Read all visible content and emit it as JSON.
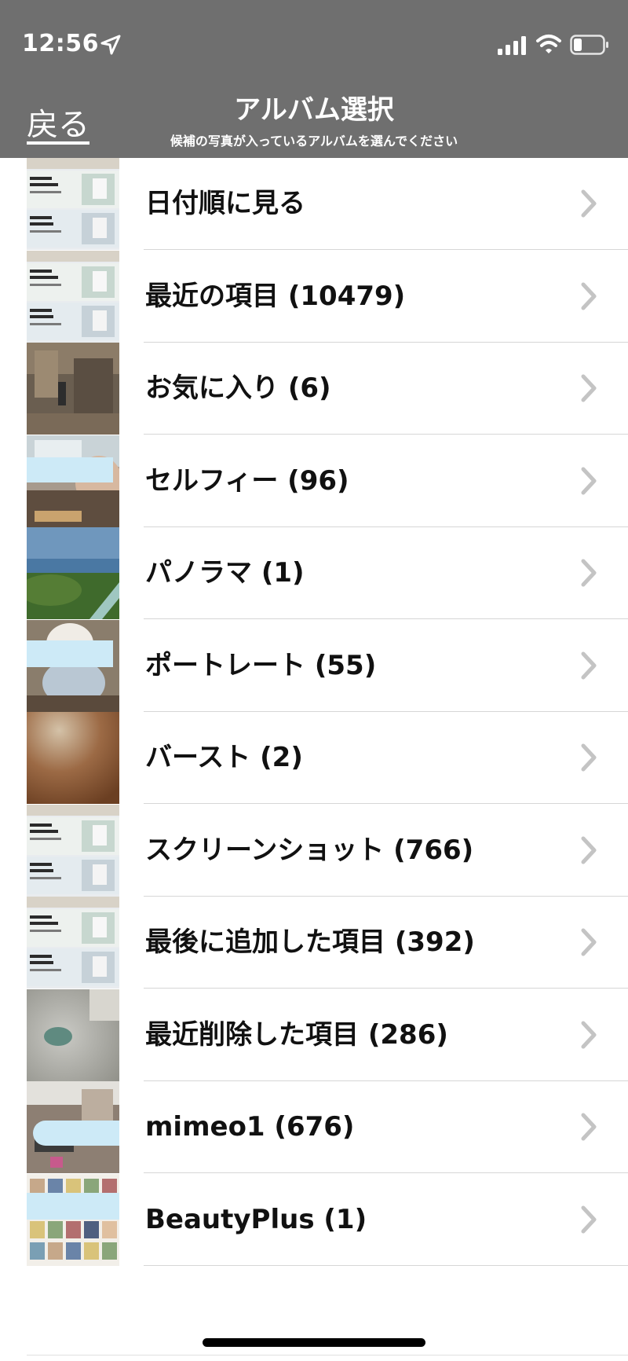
{
  "status_bar": {
    "time": "12:56"
  },
  "nav": {
    "back_label": "戻る",
    "title": "アルバム選択",
    "subtitle": "候補の写真が入っているアルバムを選んでください"
  },
  "albums": [
    {
      "label": "日付順に見る",
      "thumb": "screenshot"
    },
    {
      "label": "最近の項目 (10479)",
      "thumb": "screenshot"
    },
    {
      "label": "お気に入り (6)",
      "thumb": "room"
    },
    {
      "label": "セルフィー (96)",
      "thumb": "selfie"
    },
    {
      "label": "パノラマ (1)",
      "thumb": "sea"
    },
    {
      "label": "ポートレート (55)",
      "thumb": "child"
    },
    {
      "label": "バースト (2)",
      "thumb": "blur-brown"
    },
    {
      "label": "スクリーンショット (766)",
      "thumb": "screenshot"
    },
    {
      "label": "最後に追加した項目 (392)",
      "thumb": "screenshot"
    },
    {
      "label": "最近削除した項目 (286)",
      "thumb": "blur-gray"
    },
    {
      "label": "mimeo1 (676)",
      "thumb": "room2"
    },
    {
      "label": "BeautyPlus (1)",
      "thumb": "collage"
    }
  ],
  "colors": {
    "header_bg": "#6f6f6f",
    "chevron": "#c4c4c4",
    "separator": "#d6d6d6",
    "redaction": "#cdeaf7"
  }
}
